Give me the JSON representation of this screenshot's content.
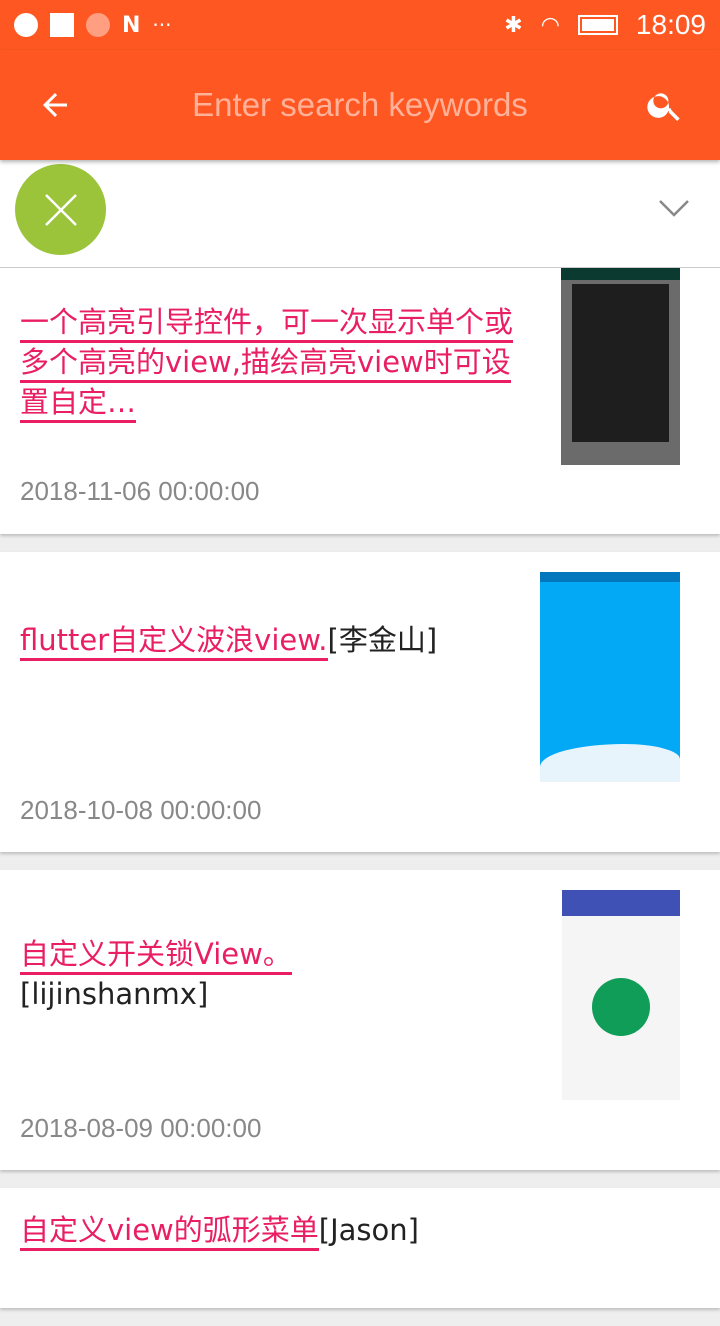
{
  "status_bar": {
    "time": "18:09",
    "left_icons": [
      "globe-icon",
      "square-icon",
      "search-app-icon",
      "n-icon",
      "more-icon"
    ],
    "right_icons": [
      "bluetooth-icon",
      "wifi-icon",
      "battery-icon"
    ]
  },
  "toolbar": {
    "search_placeholder": "Enter search keywords",
    "search_value": ""
  },
  "colors": {
    "accent": "#ff5722",
    "fab": "#9bc43b",
    "title": "#e91e63"
  },
  "articles": [
    {
      "title": "一个高亮引导控件，可一次显示单个或多个高亮的view,描绘高亮view时可设置自定…",
      "author": "",
      "date": "2018-11-06 00:00:00"
    },
    {
      "title": "flutter自定义波浪view.",
      "author": "[李金山]",
      "date": "2018-10-08 00:00:00"
    },
    {
      "title": "自定义开关锁View。",
      "author": "[lijinshanmx]",
      "date": "2018-08-09 00:00:00"
    },
    {
      "title": "自定义view的弧形菜单",
      "author": "[Jason]",
      "date": ""
    }
  ]
}
